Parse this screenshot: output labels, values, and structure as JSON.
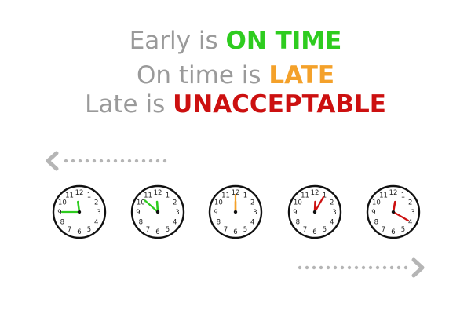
{
  "headline": {
    "lines": [
      {
        "prefix": "Early is ",
        "emphasis": "ON TIME",
        "color": "#2ecc1f"
      },
      {
        "prefix": "On time is ",
        "emphasis": "LATE",
        "color": "#f4a12a"
      },
      {
        "prefix": "Late is ",
        "emphasis": "UNACCEPTABLE",
        "color": "#cc1010"
      }
    ],
    "base_color": "#9a9a9a"
  },
  "arrows": {
    "top": {
      "direction": "left",
      "color": "#b5b5b5"
    },
    "bottom": {
      "direction": "right",
      "color": "#b5b5b5"
    }
  },
  "clock_numerals": [
    "12",
    "1",
    "2",
    "3",
    "4",
    "5",
    "6",
    "7",
    "8",
    "9",
    "10",
    "11"
  ],
  "clocks": [
    {
      "time": "11:45",
      "hand_color": "#2ecc1f"
    },
    {
      "time": "11:52",
      "hand_color": "#2ecc1f"
    },
    {
      "time": "12:00",
      "hand_color": "#f4a12a"
    },
    {
      "time": "12:05",
      "hand_color": "#cc1010"
    },
    {
      "time": "12:20",
      "hand_color": "#cc1010"
    }
  ]
}
